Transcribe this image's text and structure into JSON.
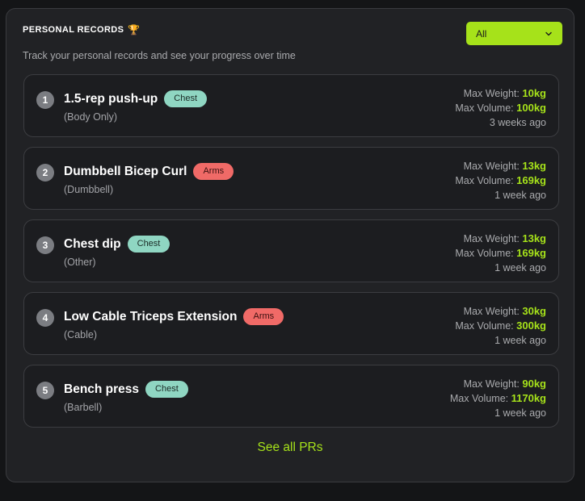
{
  "header": {
    "title": "PERSONAL RECORDS",
    "trophy_icon": "🏆",
    "subtitle": "Track your personal records and see your progress over time"
  },
  "filter": {
    "selected": "All"
  },
  "records": [
    {
      "rank": "1",
      "name": "1.5-rep push-up",
      "tag": "Chest",
      "equipment": "(Body Only)",
      "max_weight_label": "Max Weight:",
      "max_weight": "10kg",
      "max_volume_label": "Max Volume:",
      "max_volume": "100kg",
      "when": "3 weeks ago"
    },
    {
      "rank": "2",
      "name": "Dumbbell Bicep Curl",
      "tag": "Arms",
      "equipment": "(Dumbbell)",
      "max_weight_label": "Max Weight:",
      "max_weight": "13kg",
      "max_volume_label": "Max Volume:",
      "max_volume": "169kg",
      "when": "1 week ago"
    },
    {
      "rank": "3",
      "name": "Chest dip",
      "tag": "Chest",
      "equipment": "(Other)",
      "max_weight_label": "Max Weight:",
      "max_weight": "13kg",
      "max_volume_label": "Max Volume:",
      "max_volume": "169kg",
      "when": "1 week ago"
    },
    {
      "rank": "4",
      "name": "Low Cable Triceps Extension",
      "tag": "Arms",
      "equipment": "(Cable)",
      "max_weight_label": "Max Weight:",
      "max_weight": "30kg",
      "max_volume_label": "Max Volume:",
      "max_volume": "300kg",
      "when": "1 week ago"
    },
    {
      "rank": "5",
      "name": "Bench press",
      "tag": "Chest",
      "equipment": "(Barbell)",
      "max_weight_label": "Max Weight:",
      "max_weight": "90kg",
      "max_volume_label": "Max Volume:",
      "max_volume": "1170kg",
      "when": "1 week ago"
    }
  ],
  "footer": {
    "see_all_label": "See all PRs"
  },
  "colors": {
    "accent": "#a6e21a",
    "chest_tag": "#8fd6c2",
    "arms_tag": "#f06a67"
  }
}
